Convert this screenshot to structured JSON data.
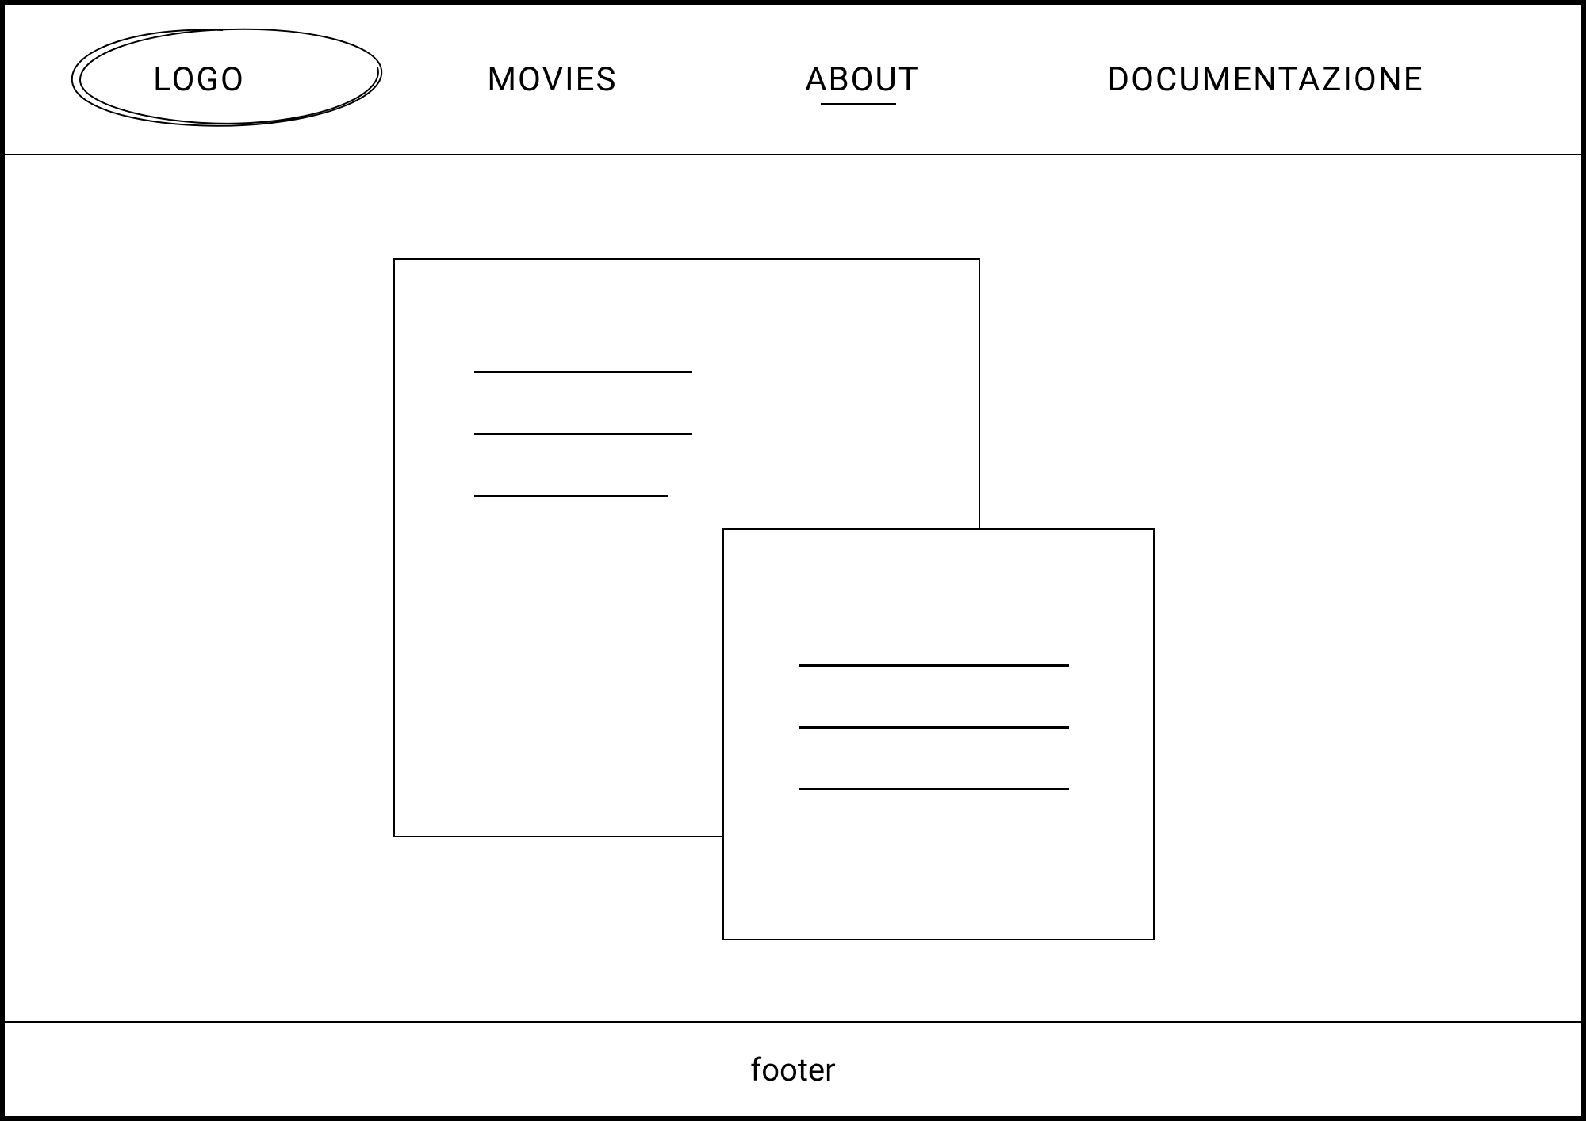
{
  "header": {
    "logo_label": "LOGO",
    "nav": [
      {
        "label": "MOVIES",
        "active": false
      },
      {
        "label": "ABOUT",
        "active": true
      },
      {
        "label": "DOCUMENTAZIONE",
        "active": false
      }
    ]
  },
  "footer": {
    "label": "footer"
  }
}
